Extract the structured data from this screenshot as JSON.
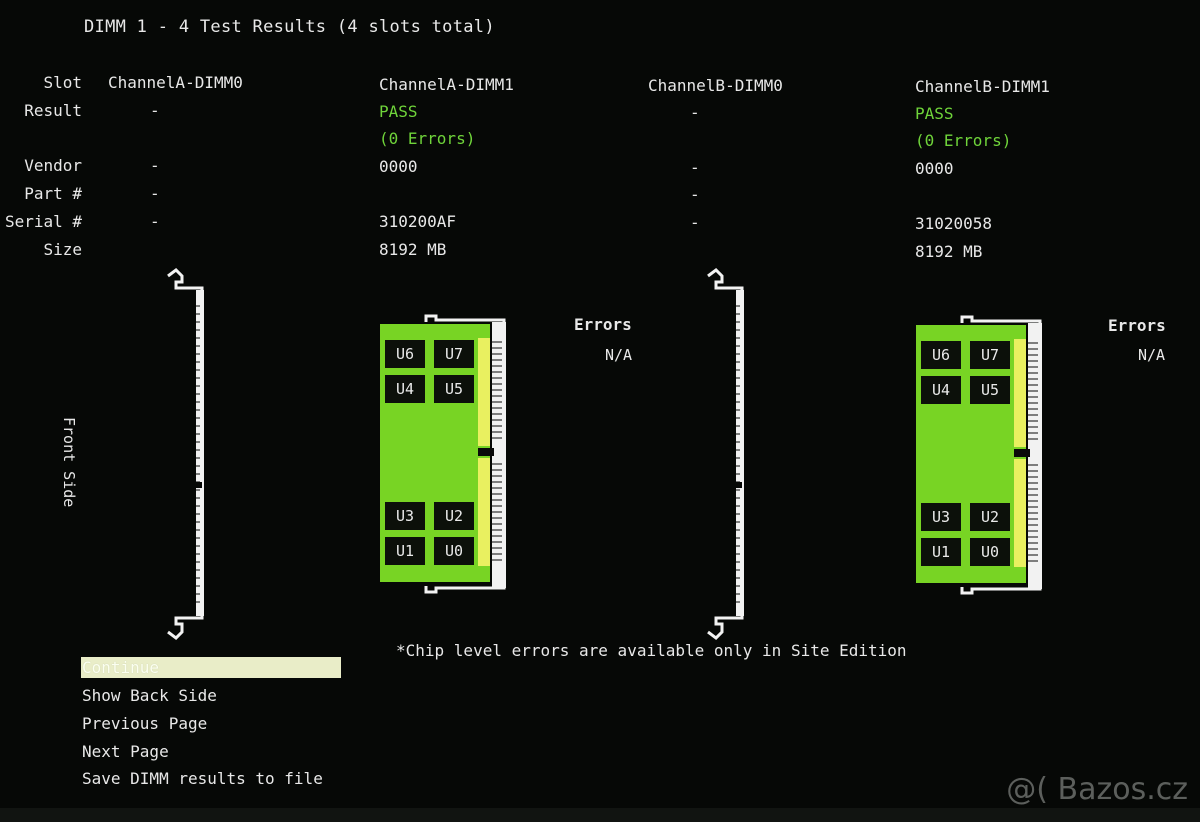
{
  "header": {
    "title": "DIMM 1 - 4 Test Results (4 slots total)"
  },
  "row_labels": {
    "slot": "Slot",
    "result": "Result",
    "vendor": "Vendor",
    "part": "Part #",
    "serial": "Serial #",
    "size": "Size"
  },
  "slots": [
    {
      "name": "ChannelA-DIMM0",
      "result": "-",
      "errors": "",
      "vendor": "-",
      "part": "-",
      "serial": "-",
      "size": ""
    },
    {
      "name": "ChannelA-DIMM1",
      "result": "PASS",
      "errors": "(0 Errors)",
      "vendor": "0000",
      "part": "",
      "serial": "310200AF",
      "size": "8192 MB"
    },
    {
      "name": "ChannelB-DIMM0",
      "result": "-",
      "errors": "",
      "vendor": "-",
      "part": "-",
      "serial": "-",
      "size": ""
    },
    {
      "name": "ChannelB-DIMM1",
      "result": "PASS",
      "errors": "(0 Errors)",
      "vendor": "0000",
      "part": "",
      "serial": "31020058",
      "size": "8192 MB"
    }
  ],
  "modules": [
    {
      "errors_heading": "Errors",
      "errors_value": "N/A",
      "chips": [
        "U6",
        "U7",
        "U4",
        "U5",
        "U3",
        "U2",
        "U1",
        "U0"
      ]
    },
    {
      "errors_heading": "Errors",
      "errors_value": "N/A",
      "chips": [
        "U6",
        "U7",
        "U4",
        "U5",
        "U3",
        "U2",
        "U1",
        "U0"
      ]
    }
  ],
  "side_label": "Front Side",
  "menu": {
    "items": [
      "Continue",
      "Show Back Side",
      "Previous Page",
      "Next Page",
      "Save DIMM results to file"
    ],
    "selected": "Continue"
  },
  "note": "*Chip level errors are available only in Site Edition",
  "watermark": "@( Bazos.cz",
  "colors": {
    "background": "#060806",
    "pass_green": "#6fd43a",
    "module_green": "#78d424",
    "slot_white": "#f2f2f2",
    "highlight": "#e9edc8"
  }
}
